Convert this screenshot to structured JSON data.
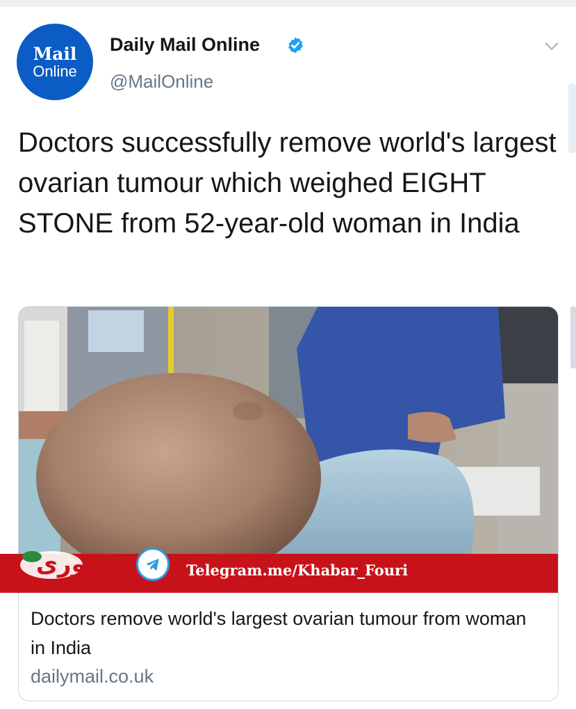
{
  "author": {
    "avatar_line1": "Mail",
    "avatar_line2": "Online",
    "name": "Daily Mail Online",
    "handle": "@MailOnline",
    "verified": true
  },
  "tweet": {
    "text": "Doctors successfully remove world's largest ovarian tumour which weighed EIGHT STONE from 52-year-old woman in India"
  },
  "card": {
    "title": "Doctors remove world's largest ovarian tumour from woman in India",
    "domain": "dailymail.co.uk"
  },
  "watermark": {
    "channel": "Telegram.me/Khabar_Fouri",
    "logo_text": "فوری"
  },
  "colors": {
    "avatar_blue": "#0b5cc4",
    "verified_blue": "#1da1f2",
    "banner_red": "#c8121a",
    "secondary_text": "#657786"
  },
  "icons": {
    "menu": "chevron-down-icon",
    "verified": "verified-badge-icon",
    "telegram": "telegram-icon"
  }
}
